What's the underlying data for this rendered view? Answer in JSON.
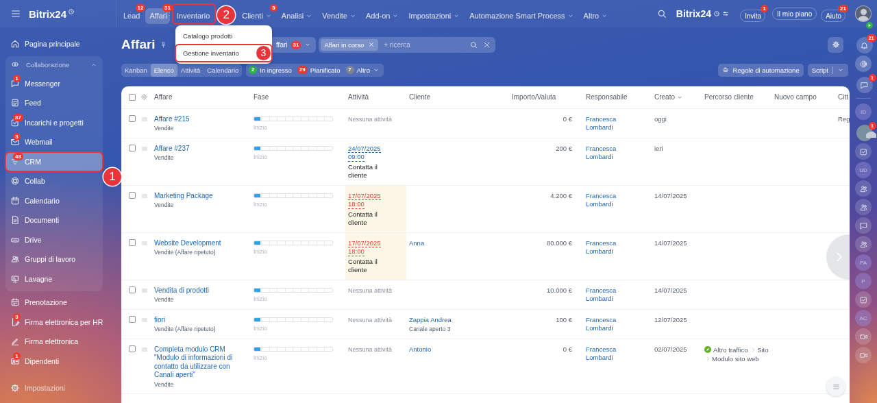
{
  "topbar": {
    "logo": "Bitrix24",
    "nav": [
      {
        "label": "Lead",
        "counter": "12",
        "selected": false,
        "caret": false
      },
      {
        "label": "Affari",
        "counter": "31",
        "selected": true,
        "caret": false
      },
      {
        "label": "Inventario",
        "selected": false,
        "caret": false
      },
      {
        "label": "Clienti",
        "counter": "5",
        "selected": false,
        "caret": true
      },
      {
        "label": "Analisi",
        "selected": false,
        "caret": true
      },
      {
        "label": "Vendite",
        "selected": false,
        "caret": true
      },
      {
        "label": "Add-on",
        "selected": false,
        "caret": true
      },
      {
        "label": "Impostazioni",
        "selected": false,
        "caret": true
      },
      {
        "label": "Automazione Smart Process",
        "selected": false,
        "caret": true
      },
      {
        "label": "Altro",
        "selected": false,
        "caret": true
      }
    ],
    "brand": "Bitrix24",
    "buttons": [
      {
        "label": "Invita",
        "counter": "1"
      },
      {
        "label": "Il mio piano"
      },
      {
        "label": "Aiuto",
        "counter": "21"
      }
    ]
  },
  "dropdown": {
    "items": [
      {
        "label": "Catalogo prodotti"
      },
      {
        "label": "Gestione inventario"
      }
    ]
  },
  "sidebar": {
    "top": [
      {
        "label": "Pagina principale",
        "selected": false
      }
    ],
    "group": {
      "title": "Collaborazione",
      "expanded": true,
      "items": [
        {
          "label": "Messenger",
          "counter": "1",
          "selected": false
        },
        {
          "label": "Feed",
          "selected": false
        },
        {
          "label": "Incarichi e progetti",
          "counter": "37",
          "selected": false
        },
        {
          "label": "Webmail",
          "counter": "3",
          "selected": false
        },
        {
          "label": "CRM",
          "counter": "48",
          "selected": true
        },
        {
          "label": "Collab",
          "selected": false
        },
        {
          "label": "Calendario",
          "selected": false
        },
        {
          "label": "Documenti",
          "selected": false
        },
        {
          "label": "Drive",
          "selected": false
        },
        {
          "label": "Gruppi di lavoro",
          "selected": false
        },
        {
          "label": "Lavagne",
          "selected": false
        }
      ]
    },
    "items": [
      {
        "label": "Prenotazione",
        "selected": false
      },
      {
        "label": "Firma elettronica per HR",
        "counter": "3",
        "selected": false
      },
      {
        "label": "Firma elettronica",
        "selected": false
      },
      {
        "label": "Dipendenti",
        "counter": "1",
        "selected": false
      }
    ],
    "settings": "Impostazioni"
  },
  "page": {
    "title": "Affari",
    "category": {
      "label": "ffari",
      "counter": "31"
    },
    "filter": {
      "chip": "Affari in corso",
      "placeholder": "+ ricerca"
    },
    "views": [
      {
        "label": "Kanban",
        "selected": false
      },
      {
        "label": "Elenco",
        "selected": true
      },
      {
        "label": "Attività",
        "selected": false
      },
      {
        "label": "Calendario",
        "selected": false
      }
    ],
    "counters": [
      {
        "count": "2",
        "label": "In ingresso",
        "color": "#2fb24c",
        "caret": false
      },
      {
        "count": "29",
        "label": "Pianificato",
        "color": "#e5362f",
        "caret": false
      },
      {
        "count": "7",
        "label": "Altro",
        "color": "#7d8592",
        "caret": true
      }
    ],
    "automation": "Regole di automazione",
    "script": "Script"
  },
  "table": {
    "select_all_checked": false,
    "columns": [
      "Affare",
      "Fase",
      "Attività",
      "Cliente",
      "Importo/Valuta",
      "Responsabile",
      "Creato",
      "Percorso cliente",
      "Nuovo campo",
      "Citt"
    ],
    "rows": [
      {
        "checked": false,
        "title": "Affare #215",
        "pipeline": "Vendite",
        "stage": "Inizio",
        "level": 0.083,
        "activity": {
          "kind": "none",
          "text": "Nessuna attività"
        },
        "amount": "0 €",
        "owner": "Francesca Lombardi",
        "created": "oggi",
        "city": "Reg"
      },
      {
        "checked": false,
        "title": "Affare #237",
        "pipeline": "Vendite",
        "stage": "Inizio",
        "level": 0.083,
        "activity": {
          "kind": "deadline",
          "date": "24/07/2025",
          "time": "09:00",
          "text": "Contatta il cliente",
          "overdue": false
        },
        "amount": "200 €",
        "owner": "Francesca Lombardi",
        "created": "ieri"
      },
      {
        "checked": false,
        "title": "Marketing Package",
        "pipeline": "Vendite",
        "stage": "Inizio",
        "level": 0.083,
        "activity": {
          "kind": "deadline",
          "date": "17/07/2025",
          "time": "18:00",
          "text": "Contatta il cliente",
          "overdue": true
        },
        "amount": "4.200 €",
        "owner": "Francesca Lombardi",
        "created": "14/07/2025"
      },
      {
        "checked": false,
        "title": "Website Development",
        "pipeline": "Vendite (Affare ripetuto)",
        "stage": "Inizio",
        "level": 0.083,
        "activity": {
          "kind": "deadline",
          "date": "17/07/2025",
          "time": "18:00",
          "text": "Contatta il cliente",
          "overdue": true
        },
        "client": "Anna",
        "amount": "80.000 €",
        "owner": "Francesca Lombardi",
        "created": "14/07/2025"
      },
      {
        "checked": false,
        "title": "Vendita di prodotti",
        "pipeline": "Vendite",
        "stage": "Inizio",
        "level": 0.083,
        "activity": {
          "kind": "none",
          "text": "Nessuna attività"
        },
        "amount": "10.000 €",
        "owner": "Francesca Lombardi",
        "created": "14/07/2025"
      },
      {
        "checked": false,
        "title": "fiori",
        "pipeline": "Vendite (Affare ripetuto)",
        "stage": "Inizio",
        "level": 0.083,
        "activity": {
          "kind": "none",
          "text": "Nessuna attività"
        },
        "client": "Zappia Andrea",
        "client_sub": "Canale aperto 3",
        "amount": "100 €",
        "owner": "Francesca Lombardi",
        "created": "12/07/2025"
      },
      {
        "checked": false,
        "title": "Completa modulo CRM \"Modulo di informazioni di contatto da utilizzare con Canali aperti\"",
        "pipeline": "Vendite",
        "stage": "Inizio",
        "level": 0.083,
        "activity": {
          "kind": "none",
          "text": "Nessuna attività"
        },
        "client": "Antonio",
        "amount": "0 €",
        "owner": "Francesca Lombardi",
        "created": "02/07/2025",
        "path": [
          "Altro traffico",
          "Sito",
          "Modulo sito web"
        ]
      }
    ]
  },
  "rail": [
    {
      "kind": "icon",
      "counter": "21"
    },
    {
      "kind": "icon"
    },
    {
      "kind": "icon",
      "counter": "1"
    },
    {
      "kind": "initials",
      "text": "ID"
    },
    {
      "kind": "avatar",
      "counter": "1"
    },
    {
      "kind": "icon"
    },
    {
      "kind": "initials",
      "text": "UD"
    },
    {
      "kind": "icon"
    },
    {
      "kind": "icon"
    },
    {
      "kind": "icon"
    },
    {
      "kind": "icon"
    },
    {
      "kind": "initials",
      "text": "PA"
    },
    {
      "kind": "initials",
      "text": "P"
    },
    {
      "kind": "icon"
    },
    {
      "kind": "initials",
      "text": "AC"
    },
    {
      "kind": "icon"
    },
    {
      "kind": "icon"
    }
  ],
  "annotations": [
    {
      "number": "1"
    },
    {
      "number": "2"
    },
    {
      "number": "3"
    }
  ]
}
